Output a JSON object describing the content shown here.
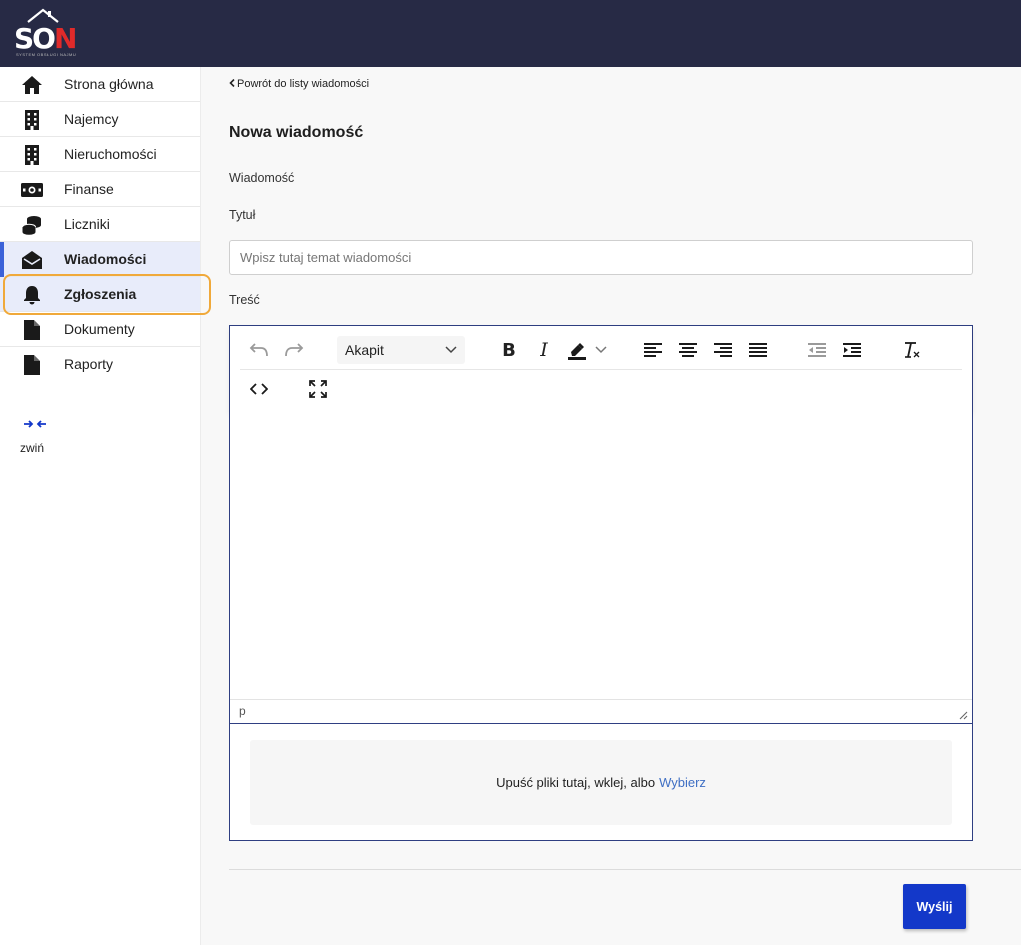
{
  "app": {
    "logo_text_main": "SO",
    "logo_text_accent": "N",
    "logo_subtitle": "SYSTEM OBSŁUGI NAJMU"
  },
  "sidebar": {
    "items": [
      {
        "label": "Strona główna",
        "icon": "home-icon"
      },
      {
        "label": "Najemcy",
        "icon": "building-icon"
      },
      {
        "label": "Nieruchomości",
        "icon": "building-icon"
      },
      {
        "label": "Finanse",
        "icon": "money-icon"
      },
      {
        "label": "Liczniki",
        "icon": "coins-icon"
      },
      {
        "label": "Wiadomości",
        "icon": "envelope-open-icon"
      },
      {
        "label": "Zgłoszenia",
        "icon": "bell-icon"
      },
      {
        "label": "Dokumenty",
        "icon": "file-icon"
      },
      {
        "label": "Raporty",
        "icon": "file-icon"
      }
    ],
    "active_item": "Wiadomości",
    "focused_item": "Zgłoszenia",
    "collapse_label": "zwiń"
  },
  "main": {
    "back_link": "Powrót do listy wiadomości",
    "title": "Nowa wiadomość",
    "section_label": "Wiadomość",
    "title_field": {
      "label": "Tytuł",
      "placeholder": "Wpisz tutaj temat wiadomości",
      "value": ""
    },
    "content_label": "Treść",
    "editor": {
      "format_select": "Akapit",
      "status_path": "p",
      "drop_zone_text": "Upuść pliki tutaj, wklej, albo",
      "drop_zone_link": "Wybierz"
    },
    "send_button": "Wyślij"
  },
  "colors": {
    "topbar": "#272a45",
    "accent_blue": "#1338c9",
    "active_nav_bg": "#e8ecfa",
    "focus_ring": "#f0a93a",
    "editor_border": "#2f3f82",
    "link_blue": "#3f6fc4"
  }
}
